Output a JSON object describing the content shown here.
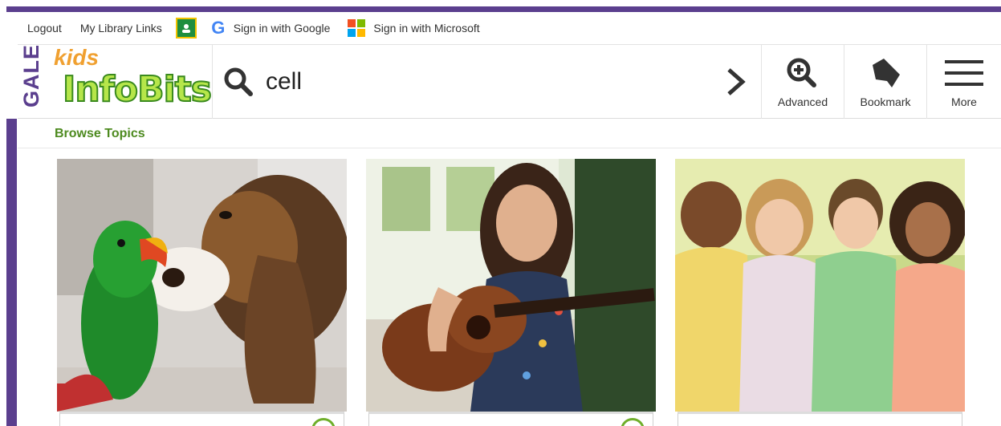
{
  "utility": {
    "logout": "Logout",
    "library_links": "My Library Links",
    "google": "Sign in with Google",
    "microsoft": "Sign in with Microsoft"
  },
  "header": {
    "logo_gale": "GALE",
    "logo_kids": "kids",
    "logo_infobits": "InfoBits",
    "search_value": "cell"
  },
  "tools": {
    "advanced": "Advanced",
    "bookmark": "Bookmark",
    "more": "More"
  },
  "browse": {
    "title": "Browse Topics"
  },
  "colors": {
    "brand_purple": "#5b3f8e",
    "browse_green": "#4d8a1f",
    "logo_green": "#b6e64a"
  },
  "cards": [
    {
      "image": "parrot-and-basset-hound-photo"
    },
    {
      "image": "girl-playing-guitar-photo"
    },
    {
      "image": "group-of-kids-photo"
    }
  ]
}
